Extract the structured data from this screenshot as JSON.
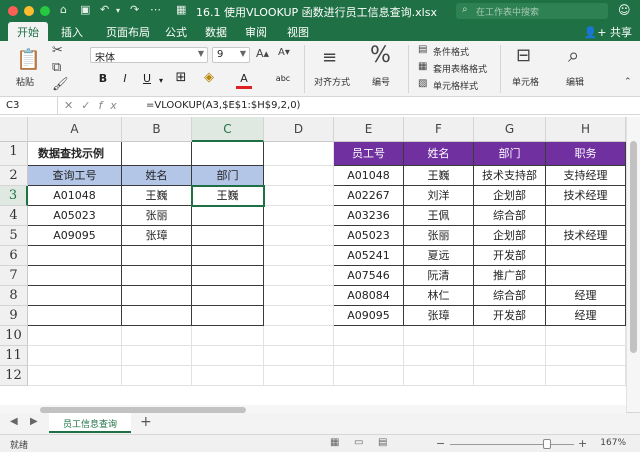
{
  "window": {
    "title": "16.1 使用VLOOKUP 函数进行员工信息查询.xlsx",
    "search_placeholder": "在工作表中搜索",
    "share": "共享",
    "colors": {
      "excel_green": "#1f7145",
      "header_blue": "#b4c6e7",
      "header_purple": "#7030a0"
    }
  },
  "ribbon": {
    "tabs": [
      "开始",
      "插入",
      "页面布局",
      "公式",
      "数据",
      "审阅",
      "视图"
    ],
    "active_tab": "开始",
    "paste_label": "粘贴",
    "font_name": "宋体",
    "font_size": "9",
    "align_label": "对齐方式",
    "number_label": "编号",
    "cond_format": "条件格式",
    "table_format": "套用表格格式",
    "cell_style": "单元格样式",
    "cells_label": "单元格",
    "edit_label": "编辑",
    "bold": "B",
    "italic": "I",
    "underline": "U",
    "font_color_glyph": "A",
    "phonetic_glyph": "abc"
  },
  "formula_bar": {
    "name_box": "C3",
    "formula": "=VLOOKUP(A3,$E$1:$H$9,2,0)",
    "icons": [
      "close-icon",
      "check-icon",
      "fx-icon"
    ]
  },
  "grid": {
    "columns": [
      "A",
      "B",
      "C",
      "D",
      "E",
      "F",
      "G",
      "H"
    ],
    "rows": [
      "1",
      "2",
      "3",
      "4",
      "5",
      "6",
      "7",
      "8",
      "9",
      "10",
      "11",
      "12"
    ],
    "selected_cell": "C3",
    "lookup": {
      "title": "数据查找示例",
      "headers": [
        "查询工号",
        "姓名",
        "部门"
      ],
      "rows": [
        [
          "A01048",
          "王巍",
          "王巍"
        ],
        [
          "A05023",
          "张丽",
          ""
        ],
        [
          "A09095",
          "张璋",
          ""
        ]
      ]
    },
    "source": {
      "headers": [
        "员工号",
        "姓名",
        "部门",
        "职务"
      ],
      "rows": [
        [
          "A01048",
          "王巍",
          "技术支持部",
          "支持经理"
        ],
        [
          "A02267",
          "刘洋",
          "企划部",
          "技术经理"
        ],
        [
          "A03236",
          "王佩",
          "综合部",
          ""
        ],
        [
          "A05023",
          "张丽",
          "企划部",
          "技术经理"
        ],
        [
          "A05241",
          "夏远",
          "开发部",
          ""
        ],
        [
          "A07546",
          "阮清",
          "推广部",
          ""
        ],
        [
          "A08084",
          "林仁",
          "综合部",
          "经理"
        ],
        [
          "A09095",
          "张璋",
          "开发部",
          "经理"
        ]
      ]
    }
  },
  "sheet_tabs": {
    "active": "员工信息查询",
    "add": "+"
  },
  "status_bar": {
    "status": "就绪",
    "zoom": "167%",
    "zoom_fraction": 0.78
  }
}
